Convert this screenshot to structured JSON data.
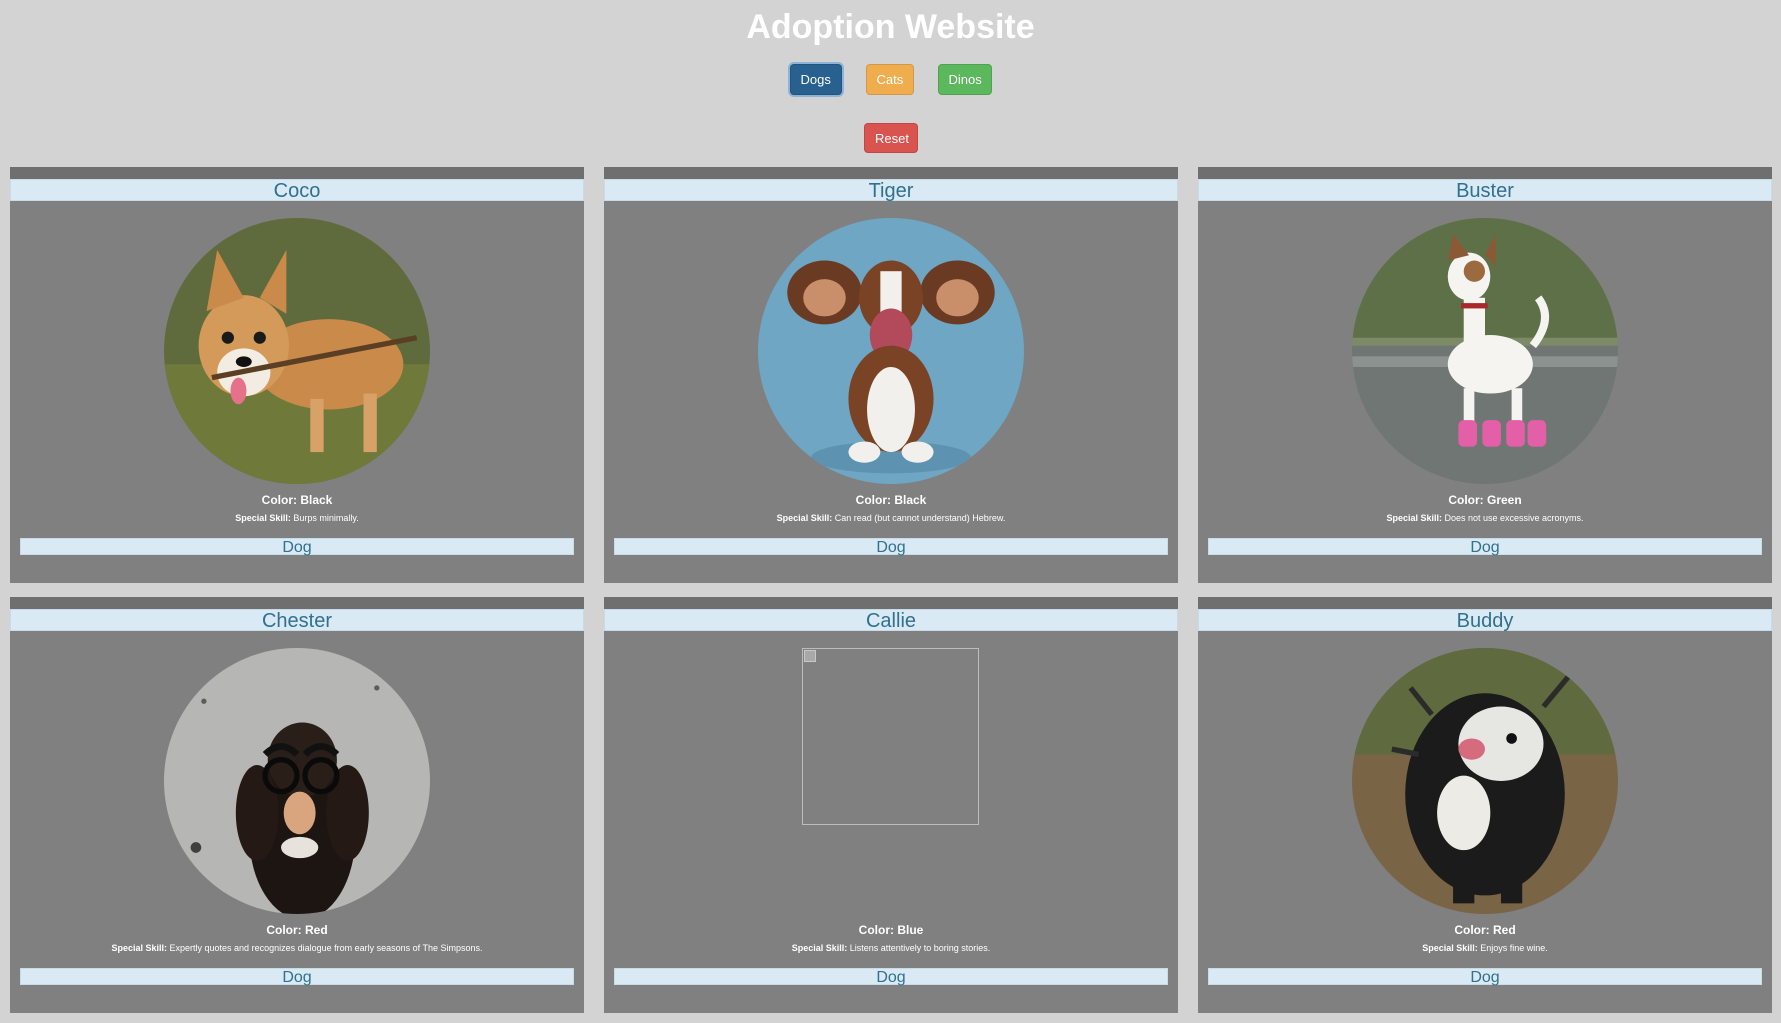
{
  "header": {
    "title": "Adoption Website"
  },
  "filters": {
    "dogs_label": "Dogs",
    "cats_label": "Cats",
    "dinos_label": "Dinos",
    "reset_label": "Reset"
  },
  "colors": {
    "background": "#d3d3d3",
    "card": "#808080",
    "banner": "#d9eaf4",
    "banner_text": "#31708f",
    "dogs_button": "#286090",
    "cats_button": "#f0ad4e",
    "dinos_button": "#5cb85c",
    "reset_button": "#d9534f"
  },
  "pets": [
    {
      "name": "Coco",
      "color": "Color: Black",
      "skill_label": "Special Skill:",
      "skill": "Burps minimally.",
      "type": "Dog",
      "photo": "corgi-with-stick"
    },
    {
      "name": "Tiger",
      "color": "Color: Black",
      "skill_label": "Special Skill:",
      "skill": "Can read (but cannot understand) Hebrew.",
      "type": "Dog",
      "photo": "basset-hound-ears"
    },
    {
      "name": "Buster",
      "color": "Color: Green",
      "skill_label": "Special Skill:",
      "skill": "Does not use excessive acronyms.",
      "type": "Dog",
      "photo": "terrier-pink-boots"
    },
    {
      "name": "Chester",
      "color": "Color: Red",
      "skill_label": "Special Skill:",
      "skill": "Expertly quotes and recognizes dialogue from early seasons of The Simpsons.",
      "type": "Dog",
      "photo": "spaniel-disguise-glasses"
    },
    {
      "name": "Callie",
      "color": "Color: Blue",
      "skill_label": "Special Skill:",
      "skill": "Listens attentively to boring stories.",
      "type": "Dog",
      "photo": "broken-image"
    },
    {
      "name": "Buddy",
      "color": "Color: Red",
      "skill_label": "Special Skill:",
      "skill": "Enjoys fine wine.",
      "type": "Dog",
      "photo": "wet-dog-shaking"
    }
  ]
}
